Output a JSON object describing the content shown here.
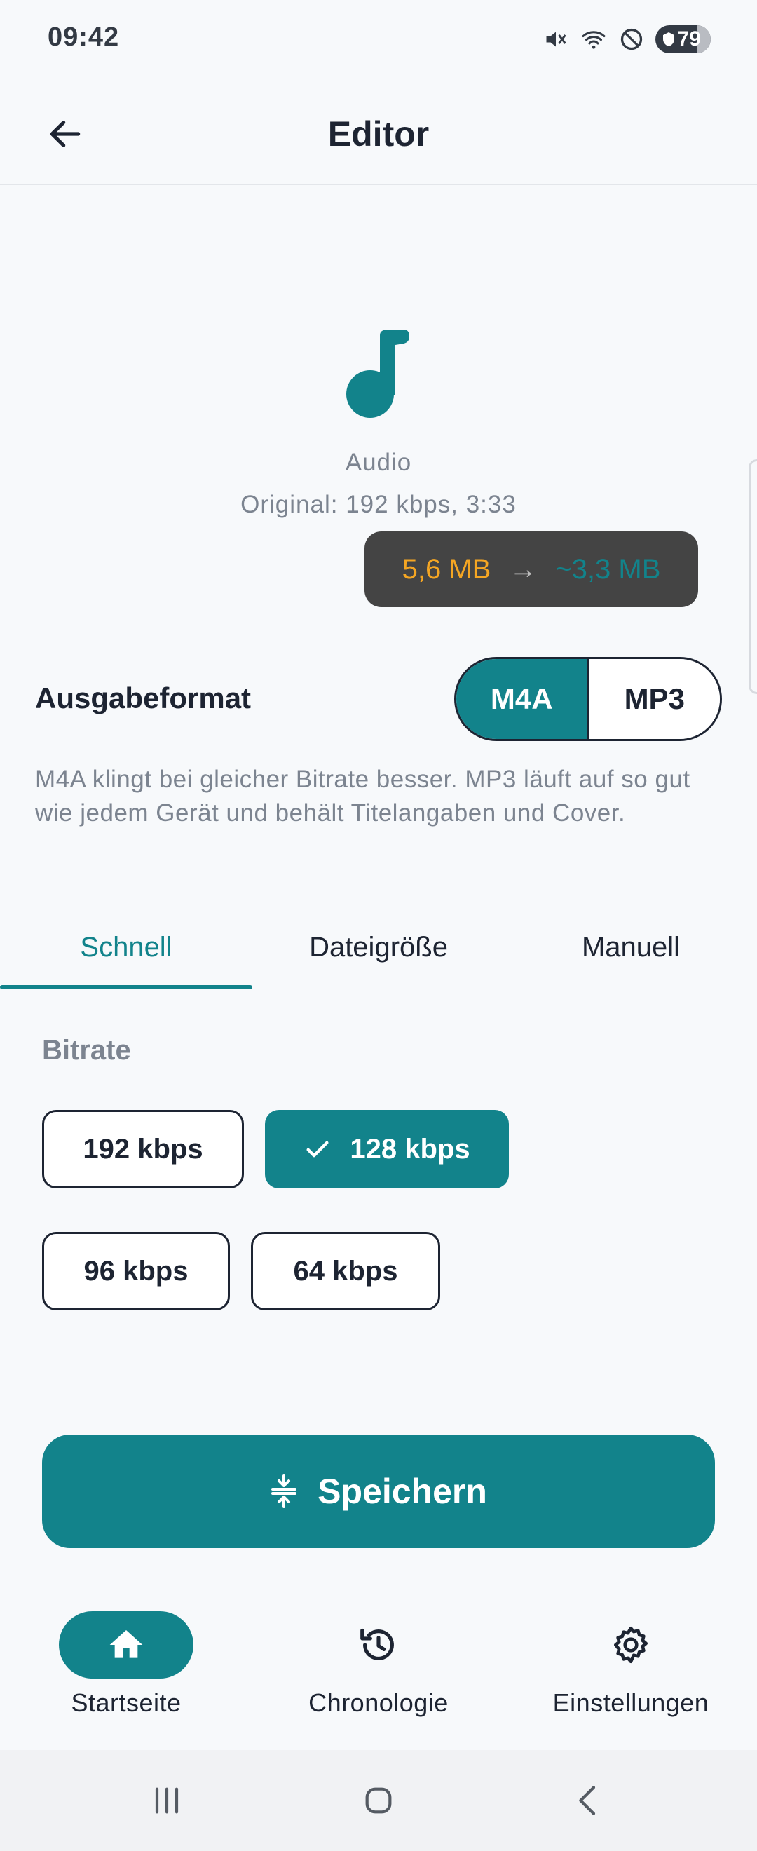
{
  "status": {
    "time": "09:42",
    "battery": "79"
  },
  "header": {
    "title": "Editor"
  },
  "media": {
    "type": "Audio",
    "original": "Original: 192 kbps, 3:33",
    "size_from": "5,6 MB",
    "size_arrow": "→",
    "size_to": "~3,3 MB"
  },
  "output": {
    "label": "Ausgabeformat",
    "options": [
      "M4A",
      "MP3"
    ],
    "selected": "M4A",
    "description": "M4A klingt bei gleicher Bitrate besser. MP3 läuft auf so gut wie jedem Gerät und behält Titelangaben und Cover."
  },
  "tabs": {
    "items": [
      "Schnell",
      "Dateigröße",
      "Manuell"
    ],
    "active": "Schnell"
  },
  "bitrate": {
    "label": "Bitrate",
    "options": [
      "192 kbps",
      "128 kbps",
      "96 kbps",
      "64 kbps"
    ],
    "selected": "128 kbps"
  },
  "actions": {
    "save_label": "Speichern"
  },
  "nav": {
    "items": [
      {
        "label": "Startseite",
        "icon": "home-icon"
      },
      {
        "label": "Chronologie",
        "icon": "history-icon"
      },
      {
        "label": "Einstellungen",
        "icon": "gear-icon"
      }
    ],
    "active": "Startseite"
  },
  "colors": {
    "accent": "#12838b",
    "size_from": "#f5a623",
    "text": "#1d2432",
    "muted": "#7c8490"
  }
}
